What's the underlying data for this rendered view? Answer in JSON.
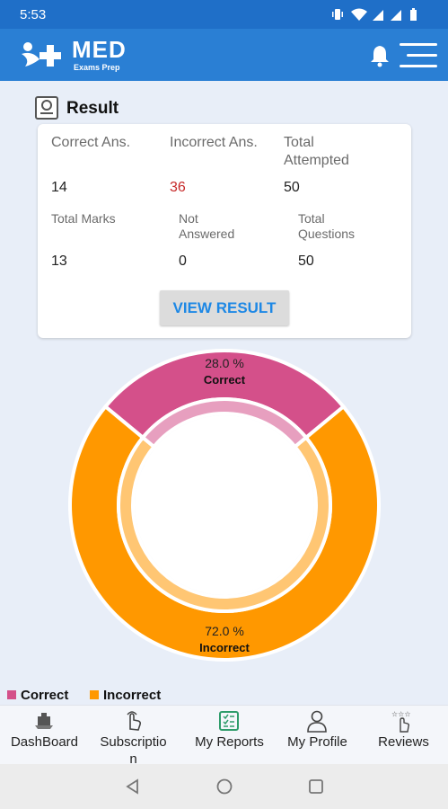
{
  "status_bar": {
    "time": "5:53",
    "icons": [
      "vibrate-icon",
      "wifi-icon",
      "signal-icon",
      "signal-icon",
      "battery-icon"
    ]
  },
  "app_bar": {
    "logo_text": "MED",
    "logo_subtext": "Exams Prep",
    "colors": {
      "primary": "#2a7fd4",
      "status": "#1f6fc8"
    },
    "icons": [
      "notification-bell-icon",
      "hamburger-menu-icon"
    ]
  },
  "result": {
    "title": "Result",
    "stats_top": [
      {
        "label": "Correct Ans.",
        "value": "14"
      },
      {
        "label": "Incorrect Ans.",
        "value": "36"
      },
      {
        "label": "Total\nAttempted",
        "value": "50"
      }
    ],
    "stats_bottom": [
      {
        "label": "Total Marks",
        "value": "13"
      },
      {
        "label": "Not\nAnswered",
        "value": "0"
      },
      {
        "label": "Total\nQuestions",
        "value": "50"
      }
    ],
    "view_button": "VIEW RESULT"
  },
  "chart_data": {
    "type": "pie",
    "variant": "donut",
    "slices": [
      {
        "label": "Correct",
        "value": 28.0,
        "value_text": "28.0 %",
        "color": "#d4508a"
      },
      {
        "label": "Incorrect",
        "value": 72.0,
        "value_text": "72.0 %",
        "color": "#ff9800"
      }
    ],
    "legend": [
      "Correct",
      "Incorrect"
    ],
    "legend_position": "bottom-left"
  },
  "bottom_nav": [
    {
      "label": "DashBoard",
      "icon": "dashboard-icon"
    },
    {
      "label": "Subscriptio\nn",
      "icon": "tap-hand-icon"
    },
    {
      "label": "My Reports",
      "icon": "reports-checklist-icon"
    },
    {
      "label": "My Profile",
      "icon": "profile-person-icon"
    },
    {
      "label": "Reviews",
      "icon": "reviews-stars-icon"
    }
  ],
  "system_nav": [
    "back-icon",
    "home-icon",
    "recents-icon"
  ]
}
